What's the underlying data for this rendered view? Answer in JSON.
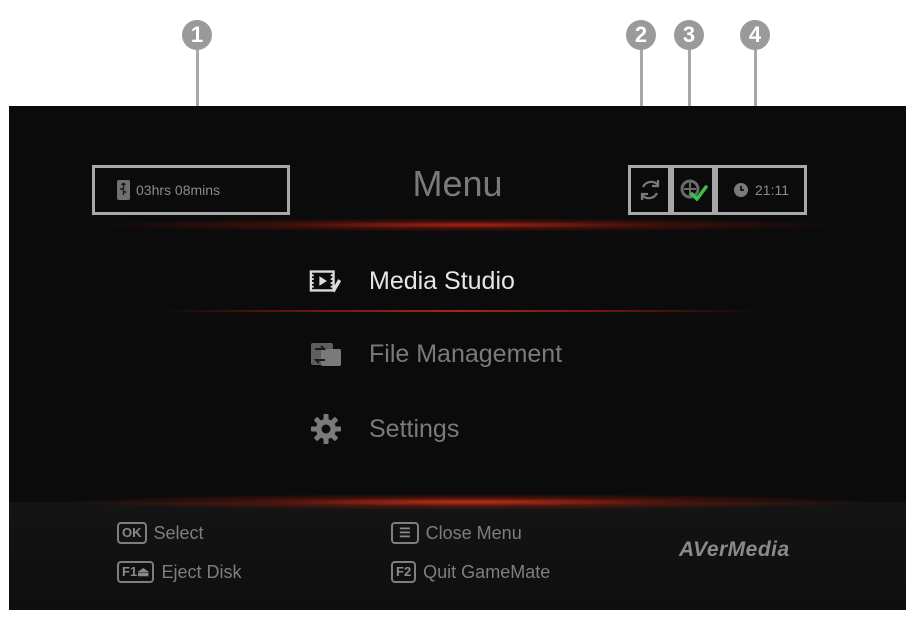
{
  "callouts": [
    "1",
    "2",
    "3",
    "4"
  ],
  "status": {
    "recording_time": "03hrs 08mins",
    "clock": "21:11"
  },
  "title": "Menu",
  "menu": {
    "items": [
      {
        "label": "Media Studio",
        "icon": "media-studio-icon",
        "selected": true
      },
      {
        "label": "File Management",
        "icon": "file-management-icon",
        "selected": false
      },
      {
        "label": "Settings",
        "icon": "gear-icon",
        "selected": false
      }
    ]
  },
  "hints": [
    {
      "key": "OK",
      "label": "Select"
    },
    {
      "key": "☰",
      "label": "Close Menu"
    },
    {
      "key": "F1⏏",
      "label": "Eject Disk"
    },
    {
      "key": "F2",
      "label": "Quit GameMate"
    }
  ],
  "brand": "AVerMedia",
  "colors": {
    "background": "#0b0b0b",
    "selected_text": "#e6e6e6",
    "normal_text": "#7a7a7a",
    "accent_glow": "#b02a18",
    "callout": "#9a9a9a",
    "check": "#3bbf4a"
  }
}
